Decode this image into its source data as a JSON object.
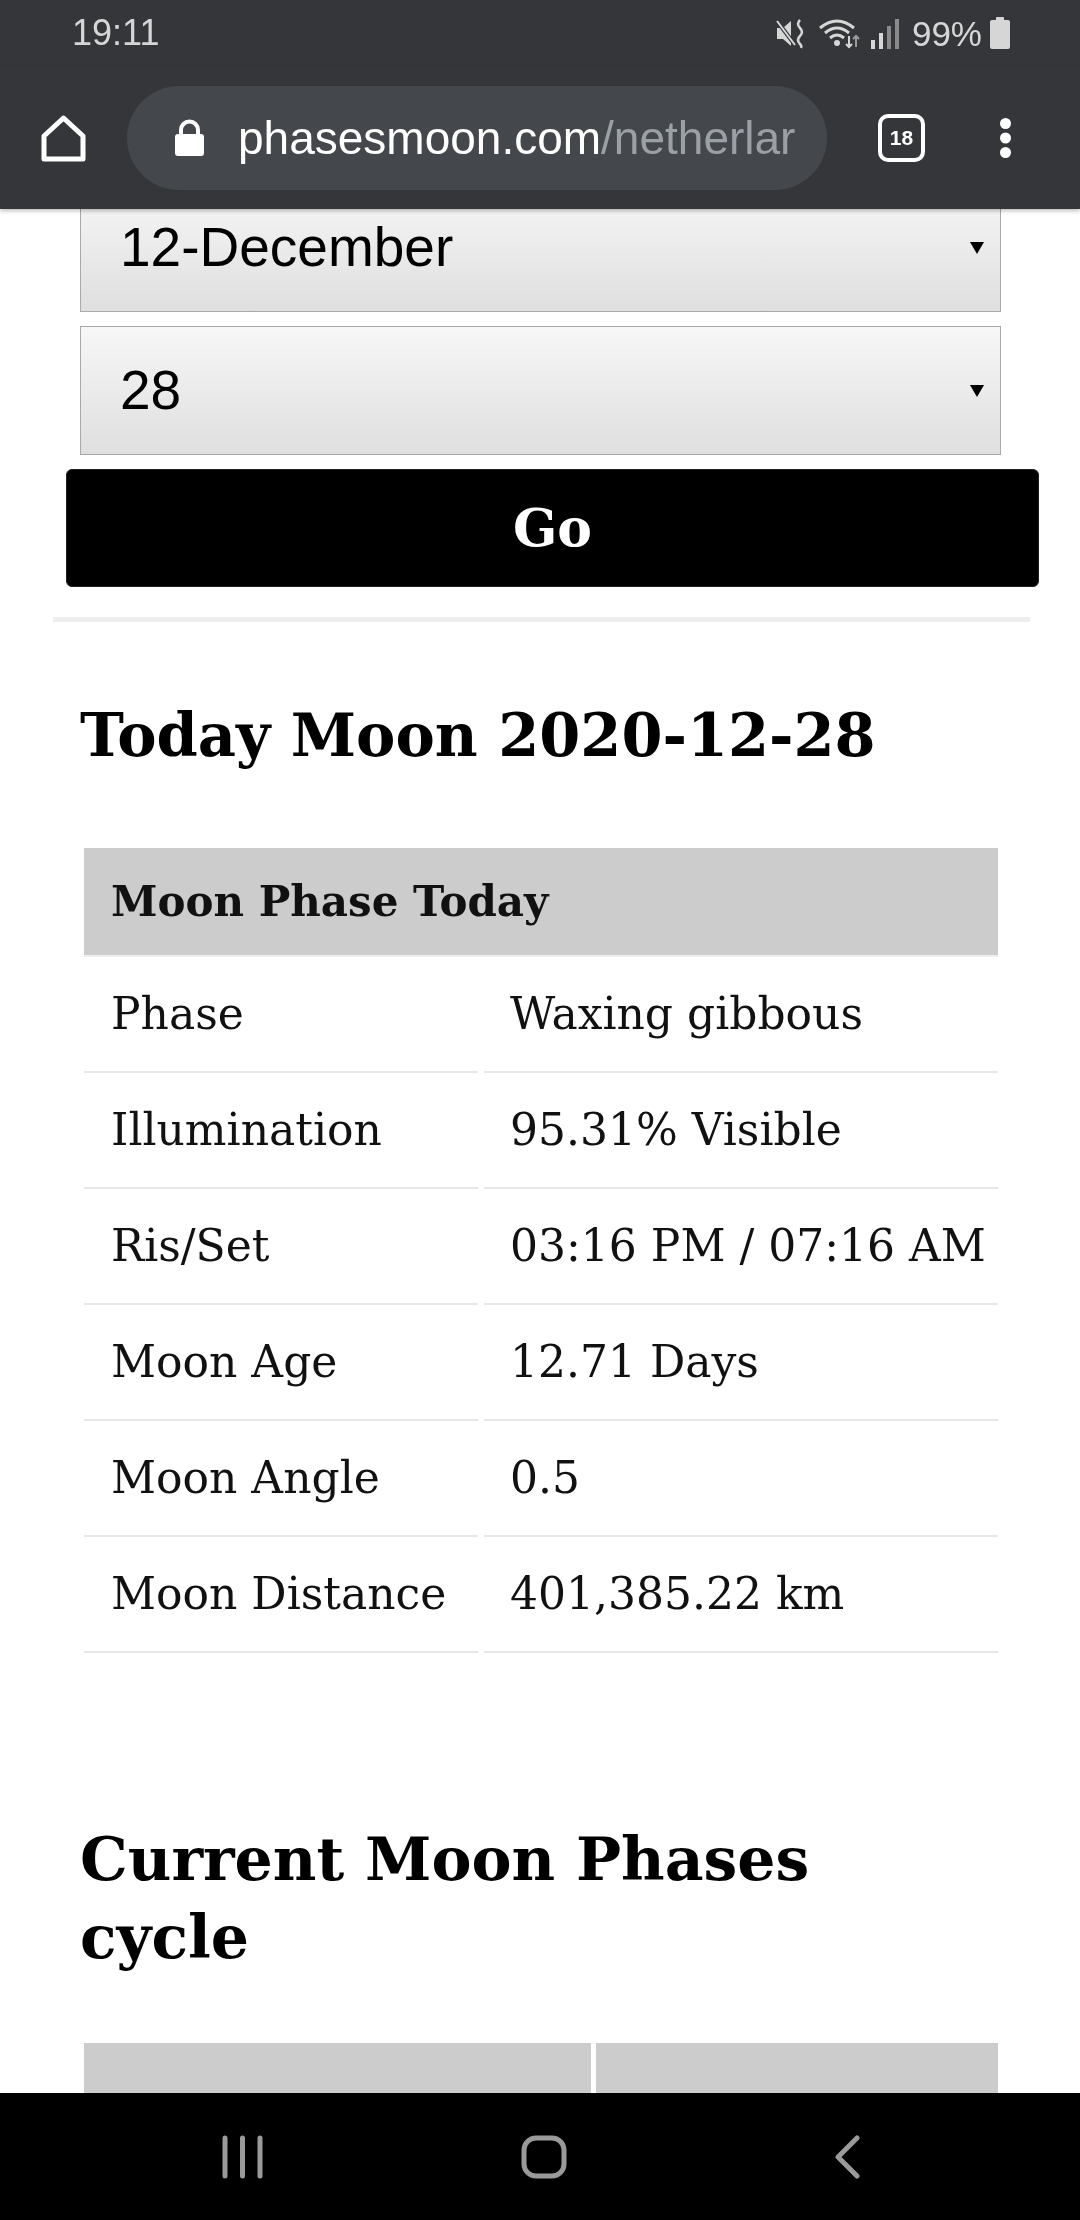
{
  "status_bar": {
    "time": "19:11",
    "battery_text": "99%"
  },
  "browser_toolbar": {
    "url_host": "phasesmoon.com",
    "url_path": "/netherlar",
    "tab_count": "18"
  },
  "date_form": {
    "selects": [
      {
        "value": "12-December"
      },
      {
        "value": "28"
      }
    ],
    "submit_button": "Go"
  },
  "today_section": {
    "heading": "Today Moon 2020-12-28",
    "table": {
      "header": "Moon Phase Today",
      "rows": [
        {
          "label": "Phase",
          "value": "Waxing gibbous"
        },
        {
          "label": "Illumination",
          "value": "95.31% Visible"
        },
        {
          "label": "Ris/Set",
          "value": "03:16 PM / 07:16 AM"
        },
        {
          "label": "Moon Age",
          "value": "12.71 Days"
        },
        {
          "label": "Moon Angle",
          "value": "0.5"
        },
        {
          "label": "Moon Distance",
          "value": "401,385.22 km"
        }
      ]
    }
  },
  "cycle_section": {
    "heading": "Current Moon Phases cycle"
  }
}
